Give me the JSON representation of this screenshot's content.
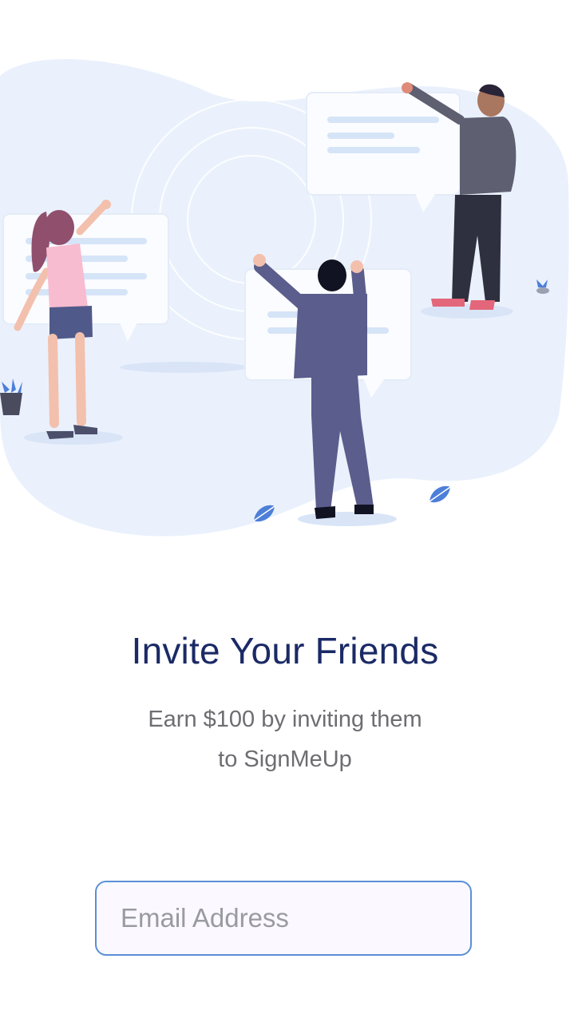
{
  "illustration": {
    "icon": "people-with-chat-bubbles-illustration",
    "colors": {
      "blob": "#eaf1fc",
      "bubble": "#fbfcff",
      "bubble_line": "#d6e4f7",
      "suit": "#5b5d8c",
      "leaf": "#4d7fd9"
    }
  },
  "invite": {
    "title": "Invite Your Friends",
    "subtitle_line1": "Earn $100 by inviting them",
    "subtitle_line2": "to SignMeUp"
  },
  "form": {
    "email_placeholder": "Email Address",
    "email_value": ""
  },
  "colors": {
    "title": "#1b2a66",
    "subtitle": "#6d6d72",
    "input_border": "#5a8fd6"
  }
}
